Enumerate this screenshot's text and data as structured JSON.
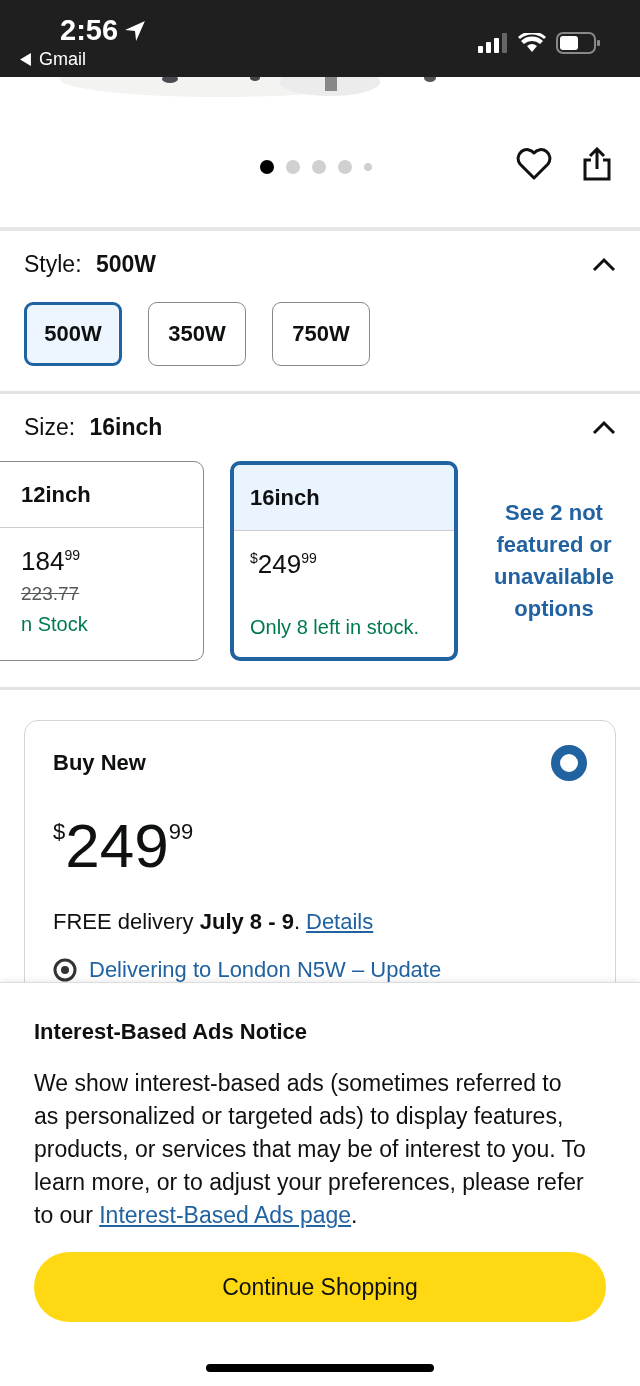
{
  "status_bar": {
    "time": "2:56",
    "back_label": "Gmail"
  },
  "carousel": {
    "dots": [
      {
        "selected": true
      },
      {
        "selected": false
      },
      {
        "selected": false
      },
      {
        "selected": false
      },
      {
        "selected": false
      }
    ]
  },
  "style": {
    "label": "Style:",
    "value": "500W",
    "expanded": true,
    "options": [
      {
        "label": "500W",
        "selected": true
      },
      {
        "label": "350W",
        "selected": false
      },
      {
        "label": "750W",
        "selected": false
      }
    ]
  },
  "size": {
    "label": "Size:",
    "value": "16inch",
    "expanded": true,
    "options": [
      {
        "label": "12inch",
        "price_whole": "184",
        "price_fraction": "99",
        "list_price": "223.77",
        "availability": "n Stock",
        "selected": false
      },
      {
        "label": "16inch",
        "currency": "$",
        "price_whole": "249",
        "price_fraction": "99",
        "availability": "Only 8 left in stock.",
        "selected": true
      }
    ],
    "more_link": "See 2 not featured or unavailable options"
  },
  "buy_box": {
    "title": "Buy New",
    "selected": true,
    "currency": "$",
    "price_whole": "249",
    "price_fraction": "99",
    "delivery": "FREE delivery **July 8 - 9**.",
    "details_link": "Details",
    "location_link": "Delivering to London N5W – Update"
  },
  "notice": {
    "title": "Interest-Based Ads Notice",
    "body": "We show interest-based ads (sometimes referred to as personalized or targeted ads) to display features, products, or services that may be of interest to you. To learn more, or to adjust your preferences, please refer to our",
    "link": "Interest-Based Ads page",
    "body_end": ".",
    "button": "Continue Shopping"
  }
}
